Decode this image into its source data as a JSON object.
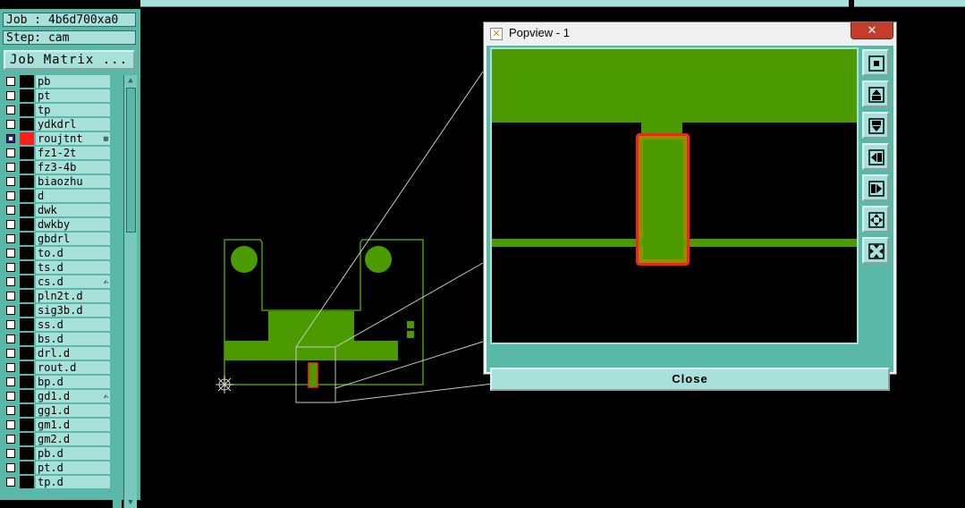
{
  "window": {
    "title": "Popview - 1",
    "close_glyph": "✕"
  },
  "job": {
    "label": "Job : 4b6d700xa0",
    "step": "Step: cam"
  },
  "job_matrix_button": "Job Matrix ...",
  "layers": [
    {
      "name": "pb",
      "selected": false,
      "color": "#000000",
      "flag": ""
    },
    {
      "name": "pt",
      "selected": false,
      "color": "#000000",
      "flag": ""
    },
    {
      "name": "tp",
      "selected": false,
      "color": "#000000",
      "flag": ""
    },
    {
      "name": "ydkdrl",
      "selected": false,
      "color": "#000000",
      "flag": ""
    },
    {
      "name": "roujtnt",
      "selected": true,
      "color": "#ff1e1e",
      "flag": "⊞"
    },
    {
      "name": "fz1-2t",
      "selected": false,
      "color": "#000000",
      "flag": ""
    },
    {
      "name": "fz3-4b",
      "selected": false,
      "color": "#000000",
      "flag": ""
    },
    {
      "name": "biaozhu",
      "selected": false,
      "color": "#000000",
      "flag": ""
    },
    {
      "name": "d",
      "selected": false,
      "color": "#000000",
      "flag": ""
    },
    {
      "name": "dwk",
      "selected": false,
      "color": "#000000",
      "flag": ""
    },
    {
      "name": "dwkby",
      "selected": false,
      "color": "#000000",
      "flag": ""
    },
    {
      "name": "gbdrl",
      "selected": false,
      "color": "#000000",
      "flag": ""
    },
    {
      "name": "to.d",
      "selected": false,
      "color": "#000000",
      "flag": ""
    },
    {
      "name": "ts.d",
      "selected": false,
      "color": "#000000",
      "flag": ""
    },
    {
      "name": "cs.d",
      "selected": false,
      "color": "#000000",
      "flag": "✍"
    },
    {
      "name": "pln2t.d",
      "selected": false,
      "color": "#000000",
      "flag": ""
    },
    {
      "name": "sig3b.d",
      "selected": false,
      "color": "#000000",
      "flag": ""
    },
    {
      "name": "ss.d",
      "selected": false,
      "color": "#000000",
      "flag": ""
    },
    {
      "name": "bs.d",
      "selected": false,
      "color": "#000000",
      "flag": ""
    },
    {
      "name": "drl.d",
      "selected": false,
      "color": "#000000",
      "flag": ""
    },
    {
      "name": "rout.d",
      "selected": false,
      "color": "#000000",
      "flag": ""
    },
    {
      "name": "bp.d",
      "selected": false,
      "color": "#000000",
      "flag": ""
    },
    {
      "name": "gd1.d",
      "selected": false,
      "color": "#000000",
      "flag": "✍"
    },
    {
      "name": "gg1.d",
      "selected": false,
      "color": "#000000",
      "flag": ""
    },
    {
      "name": "gm1.d",
      "selected": false,
      "color": "#000000",
      "flag": ""
    },
    {
      "name": "gm2.d",
      "selected": false,
      "color": "#000000",
      "flag": ""
    },
    {
      "name": "pb.d",
      "selected": false,
      "color": "#000000",
      "flag": ""
    },
    {
      "name": "pt.d",
      "selected": false,
      "color": "#000000",
      "flag": ""
    },
    {
      "name": "tp.d",
      "selected": false,
      "color": "#000000",
      "flag": ""
    }
  ],
  "popview": {
    "close_button": "Close",
    "tools": [
      "zoom-fit-icon",
      "pan-up-icon",
      "pan-down-icon",
      "pan-left-icon",
      "pan-right-icon",
      "zoom-in-icon",
      "zoom-out-icon"
    ]
  },
  "colors": {
    "copper": "#4a9a00",
    "highlight": "#ff1e1e",
    "overlap": "#9a8a00",
    "panel": "#5ab8a8",
    "panel_light": "#a8e0da",
    "outline": "#6cd44a"
  }
}
